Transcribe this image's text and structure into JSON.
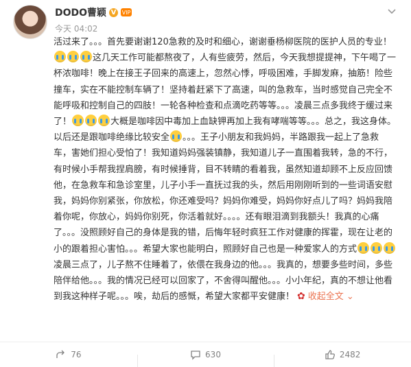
{
  "user": {
    "name": "DODO曹颖",
    "verified_badge": "V",
    "vip_badge": "VIP",
    "timestamp": "今天 04:02"
  },
  "post": {
    "segments": [
      "活过来了。。。首先要谢谢120急救的及时和细心，谢谢垂杨柳医院的医护人员的专业！",
      "这几天工作可能都熬夜了，人有些疲劳，然后，今天我想提提神，下午喝了一杯浓咖啡！晚上在接王子回来的高速上，忽然心悸，呼吸困难，手脚发麻，抽筋！险些撞车，实在不能控制车辆了！坚持着赶紧下了高速，叫的急救车，当时感觉自己完全不能呼吸和控制自己的四肢！一轮各种检查和点滴吃药等等。。。凌晨三点多我终于缓过来了！",
      "大概是咖啡因中毒加上血缺钾再加上我有哮喘等等。。。总之，我这身体。以后还是跟咖啡绝缘比较安全",
      "。。。王子小朋友和我妈妈，半路跟我一起上了急救车，害她们担心受怕了！我知道妈妈强装镇静，我知道儿子一直围着我转，急的不行，有时候小手帮我捏肩膀，有时候捶背，目不转睛的看着我，虽然知道却顾不上反应回馈他，在急救车和急诊室里，儿子小手一直抚过我的头，然后用刚刚听到的一些词语安慰我，妈妈你别紧张，你放松，你还难受吗？妈妈你难受，妈妈你好点儿了吗？妈妈我陪着你呢，你放心，妈妈你别死，你活着就好。。。。还有眼泪滴到我额头！我真的心痛了。。。没照顾好自己的身体是我的错，后悔年轻时疯狂工作对健康的挥霍，现在让老的小的跟着担心害怕。。。希望大家也能明白，照顾好自己也是一种爱家人的方式",
      "凌晨三点了，儿子熬不住睡着了，依偎在我身边的他。。。我真的，想要多些时间，多些陪伴给他。。。我的情况已经可以回家了，不舍得叫醒他。。。小小年纪，真的不想让他看到我这种样子呢。。。唉，劫后的感慨，希望大家都平安健康！"
    ],
    "expand_label": "收起全文"
  },
  "actions": {
    "share_count": "76",
    "comment_count": "630",
    "like_count": "2482"
  },
  "colors": {
    "link": "#eb7350",
    "muted": "#808080",
    "text": "#333333"
  }
}
